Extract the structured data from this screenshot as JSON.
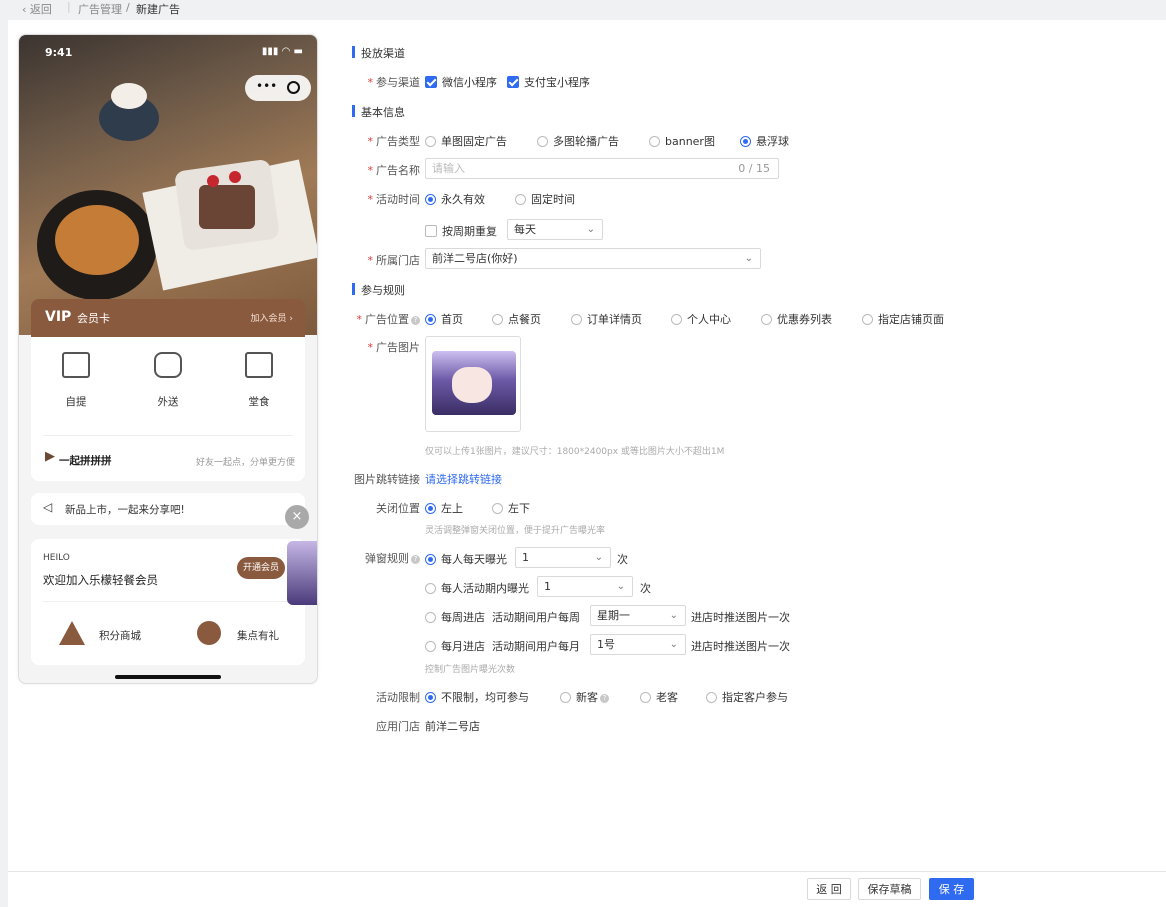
{
  "topbar": {
    "back": "返回",
    "breadcrumb_parent": "广告管理",
    "breadcrumb_sep": "/",
    "breadcrumb_current": "新建广告"
  },
  "preview": {
    "status_time": "9:41",
    "vip_logo": "VIP",
    "vip_title": "会员卡",
    "vip_join": "加入会员 ›",
    "services": [
      {
        "label": "自提",
        "icon": "cake-icon"
      },
      {
        "label": "外送",
        "icon": "delivery-scooter-icon"
      },
      {
        "label": "堂食",
        "icon": "storefront-icon"
      }
    ],
    "group_buy_title": "一起拼拼拼",
    "group_buy_desc": "好友一起点，分单更方便",
    "notice": "新品上市，一起来分享吧!",
    "member_hello": "HEILO",
    "member_welcome": "欢迎加入乐檬轻餐会员",
    "member_open": "开通会员",
    "points_mall": "积分商城",
    "stamps_gift": "集点有礼",
    "close_symbol": "×"
  },
  "sections": {
    "channel": "投放渠道",
    "basic": "基本信息",
    "rules": "参与规则"
  },
  "channel": {
    "label": "参与渠道",
    "options": [
      {
        "label": "微信小程序",
        "checked": true
      },
      {
        "label": "支付宝小程序",
        "checked": true
      }
    ]
  },
  "ad_type": {
    "label": "广告类型",
    "options": [
      {
        "label": "单图固定广告",
        "selected": false
      },
      {
        "label": "多图轮播广告",
        "selected": false
      },
      {
        "label": "banner图",
        "selected": false
      },
      {
        "label": "悬浮球",
        "selected": true
      }
    ]
  },
  "ad_name": {
    "label": "广告名称",
    "placeholder": "请输入",
    "counter": "0 / 15"
  },
  "active_time": {
    "label": "活动时间",
    "options": [
      {
        "label": "永久有效",
        "selected": true
      },
      {
        "label": "固定时间",
        "selected": false
      }
    ],
    "repeat_label": "按周期重复",
    "repeat_checked": false,
    "repeat_value": "每天"
  },
  "store": {
    "label": "所属门店",
    "value": "前洋二号店(你好)"
  },
  "ad_position": {
    "label": "广告位置",
    "options": [
      {
        "label": "首页",
        "selected": true
      },
      {
        "label": "点餐页",
        "selected": false
      },
      {
        "label": "订单详情页",
        "selected": false
      },
      {
        "label": "个人中心",
        "selected": false
      },
      {
        "label": "优惠券列表",
        "selected": false
      },
      {
        "label": "指定店铺页面",
        "selected": false
      }
    ]
  },
  "ad_image": {
    "label": "广告图片",
    "hint": "仅可以上传1张图片，建议尺寸：1800*2400px 或等比图片大小不超出1M"
  },
  "jump_link": {
    "label": "图片跳转链接",
    "link_text": "请选择跳转链接"
  },
  "close_position": {
    "label": "关闭位置",
    "options": [
      {
        "label": "左上",
        "selected": true
      },
      {
        "label": "左下",
        "selected": false
      }
    ],
    "hint": "灵活调整弹窗关闭位置，便于提升广告曝光率"
  },
  "popup_rule": {
    "label": "弹窗规则",
    "daily": {
      "label": "每人每天曝光",
      "value": "1",
      "unit": "次",
      "selected": true
    },
    "period": {
      "label": "每人活动期内曝光",
      "value": "1",
      "unit": "次",
      "selected": false
    },
    "weekly": {
      "label": "每周进店",
      "middle": "活动期间用户每周",
      "value": "星期一",
      "suffix": "进店时推送图片一次",
      "selected": false
    },
    "monthly": {
      "label": "每月进店",
      "middle": "活动期间用户每月",
      "value": "1号",
      "suffix": "进店时推送图片一次",
      "selected": false
    },
    "hint": "控制广告图片曝光次数"
  },
  "restriction": {
    "label": "活动限制",
    "options": [
      {
        "label": "不限制，均可参与",
        "selected": true
      },
      {
        "label": "新客",
        "selected": false
      },
      {
        "label": "老客",
        "selected": false
      },
      {
        "label": "指定客户参与",
        "selected": false
      }
    ]
  },
  "apply_store": {
    "label": "应用门店",
    "value": "前洋二号店"
  },
  "footer": {
    "back": "返 回",
    "draft": "保存草稿",
    "save": "保 存"
  },
  "colors": {
    "primary": "#2f6bf0",
    "required": "#e23a3a",
    "vip_brown": "#8a5a3e"
  }
}
